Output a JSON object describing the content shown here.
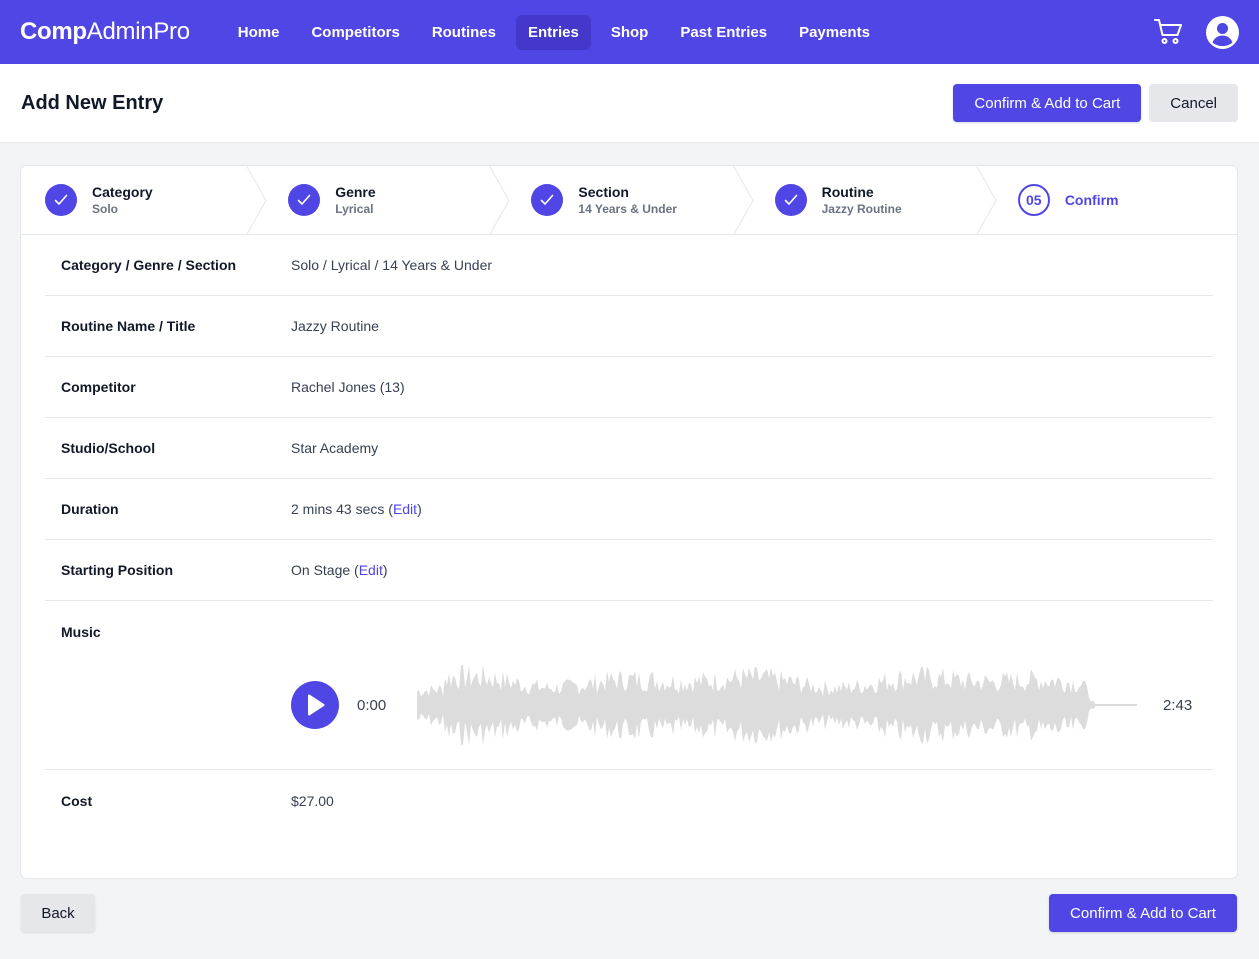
{
  "brand": {
    "bold": "Comp",
    "light": "AdminPro"
  },
  "nav": {
    "items": [
      {
        "label": "Home",
        "active": false
      },
      {
        "label": "Competitors",
        "active": false
      },
      {
        "label": "Routines",
        "active": false
      },
      {
        "label": "Entries",
        "active": true
      },
      {
        "label": "Shop",
        "active": false
      },
      {
        "label": "Past Entries",
        "active": false
      },
      {
        "label": "Payments",
        "active": false
      }
    ],
    "cart_icon": "cart-icon",
    "user_icon": "user-circle-icon"
  },
  "header": {
    "title": "Add New Entry",
    "confirm_label": "Confirm & Add to Cart",
    "cancel_label": "Cancel"
  },
  "steps": [
    {
      "name": "Category",
      "sub": "Solo",
      "status": "complete"
    },
    {
      "name": "Genre",
      "sub": "Lyrical",
      "status": "complete"
    },
    {
      "name": "Section",
      "sub": "14 Years & Under",
      "status": "complete"
    },
    {
      "name": "Routine",
      "sub": "Jazzy Routine",
      "status": "complete"
    },
    {
      "name": "Confirm",
      "number": "05",
      "status": "current"
    }
  ],
  "details": {
    "category": {
      "label": "Category / Genre / Section",
      "value": "Solo / Lyrical / 14 Years & Under"
    },
    "routine": {
      "label": "Routine Name / Title",
      "value": "Jazzy Routine"
    },
    "competitor": {
      "label": "Competitor",
      "value": "Rachel Jones (13)"
    },
    "studio": {
      "label": "Studio/School",
      "value": "Star Academy"
    },
    "duration": {
      "label": "Duration",
      "value": "2 mins 43 secs",
      "edit": "Edit"
    },
    "starting": {
      "label": "Starting Position",
      "value": "On Stage",
      "edit": "Edit"
    },
    "music": {
      "label": "Music",
      "start_time": "0:00",
      "end_time": "2:43",
      "progress": 0
    },
    "cost": {
      "label": "Cost",
      "value": "$27.00"
    }
  },
  "footer": {
    "back_label": "Back",
    "confirm_label": "Confirm & Add to Cart"
  },
  "colors": {
    "accent": "#4f46e5",
    "accent_dark": "#4338ca",
    "wave": "#dcdcdc"
  }
}
